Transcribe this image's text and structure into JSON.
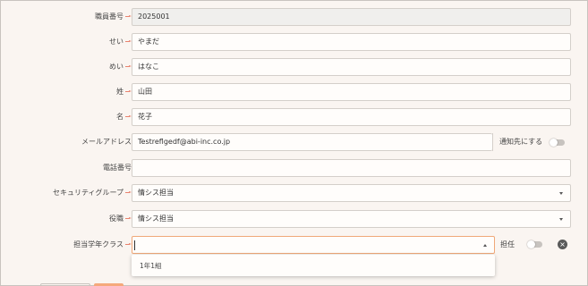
{
  "form": {
    "staff_number": {
      "label": "職員番号",
      "value": "2025001"
    },
    "sei_kana": {
      "label": "せい",
      "value": "やまだ"
    },
    "mei_kana": {
      "label": "めい",
      "value": "はなこ"
    },
    "sei": {
      "label": "姓",
      "value": "山田"
    },
    "mei": {
      "label": "名",
      "value": "花子"
    },
    "email": {
      "label": "メールアドレス",
      "value": "Testreflgedf@abi-inc.co.jp",
      "notify_label": "通知先にする"
    },
    "phone": {
      "label": "電話番号",
      "value": ""
    },
    "security_group": {
      "label": "セキュリティグループ",
      "value": "情シス担当"
    },
    "role": {
      "label": "役職",
      "value": "情シス担当"
    },
    "grade_class": {
      "label": "担当学年クラス",
      "value": "",
      "homeroom_label": "担任",
      "options": [
        "1年1組"
      ]
    }
  },
  "colors": {
    "required_arrow": "#e8826e",
    "focus_border": "#f0a878",
    "background": "#faf5f1"
  },
  "icons": {
    "required": "required-arrow-icon",
    "caret": "chevron-down-icon",
    "clear": "close-circle-icon"
  }
}
